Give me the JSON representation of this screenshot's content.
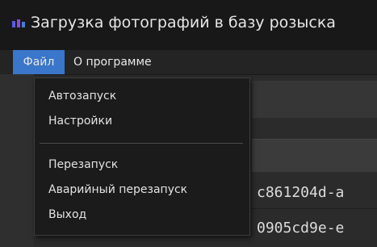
{
  "window": {
    "title": "Загрузка фотографий в базу розыска"
  },
  "menubar": {
    "items": [
      {
        "label": "Файл",
        "active": true
      },
      {
        "label": "О программе",
        "active": false
      }
    ]
  },
  "file_menu": {
    "groups": [
      [
        "Автозапуск",
        "Настройки"
      ],
      [
        "Перезапуск",
        "Аварийный перезапуск",
        "Выход"
      ]
    ]
  },
  "background": {
    "rows": [
      "c861204d-a",
      "0905cd9e-e"
    ]
  },
  "colors": {
    "accent": "#3a76c9",
    "title_bg": "#181818",
    "menu_bg": "#1b1b1b"
  },
  "icons": {
    "app": "app-icon"
  }
}
